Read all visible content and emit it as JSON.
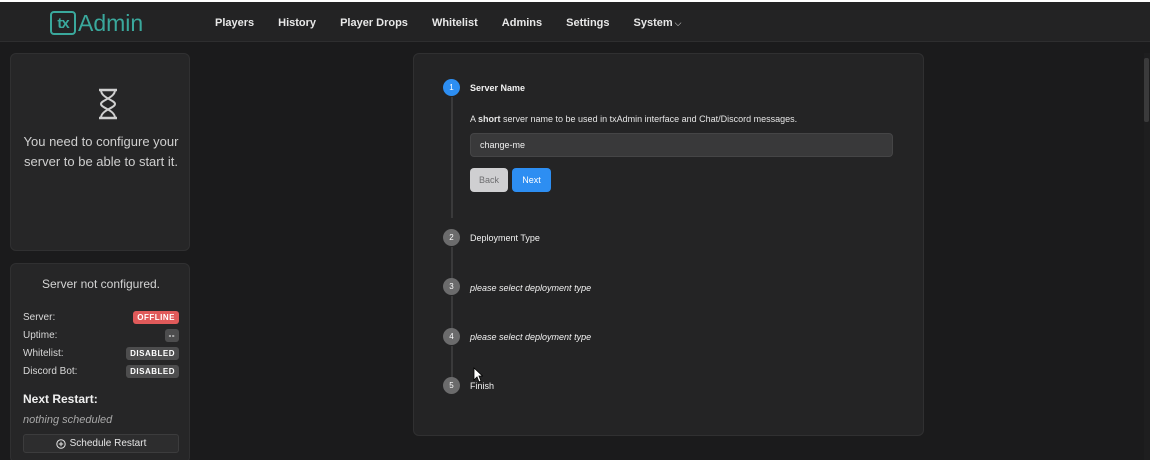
{
  "app": {
    "logo_mark": "tx",
    "logo_text": "Admin"
  },
  "nav": {
    "items": [
      {
        "label": "Players"
      },
      {
        "label": "History"
      },
      {
        "label": "Player Drops"
      },
      {
        "label": "Whitelist"
      },
      {
        "label": "Admins"
      },
      {
        "label": "Settings"
      }
    ],
    "system_label": "System",
    "system_caret": "⌵"
  },
  "warning": {
    "icon": "hourglass-icon",
    "text": "You need to configure your server to be able to start it."
  },
  "status": {
    "title": "Server not configured.",
    "rows": [
      {
        "label": "Server:",
        "value": "OFFLINE"
      },
      {
        "label": "Uptime:",
        "value": "--"
      },
      {
        "label": "Whitelist:",
        "value": "DISABLED"
      },
      {
        "label": "Discord Bot:",
        "value": "DISABLED"
      }
    ],
    "next_restart_title": "Next Restart:",
    "next_restart_value": "nothing scheduled",
    "schedule_button": "Schedule Restart"
  },
  "wizard": {
    "steps": [
      {
        "number": "1",
        "label": "Server Name"
      },
      {
        "number": "2",
        "label": "Deployment Type"
      },
      {
        "number": "3",
        "label": "please select deployment type"
      },
      {
        "number": "4",
        "label": "please select deployment type"
      },
      {
        "number": "5",
        "label": "Finish"
      }
    ],
    "description_prefix": "A ",
    "description_bold": "short",
    "description_rest": " server name to be used in txAdmin interface and Chat/Discord messages.",
    "input_value": "change-me",
    "back_label": "Back",
    "next_label": "Next"
  },
  "colors": {
    "brand": "#3aa89c",
    "primary": "#2d8ef2",
    "danger": "#e05a5a"
  }
}
